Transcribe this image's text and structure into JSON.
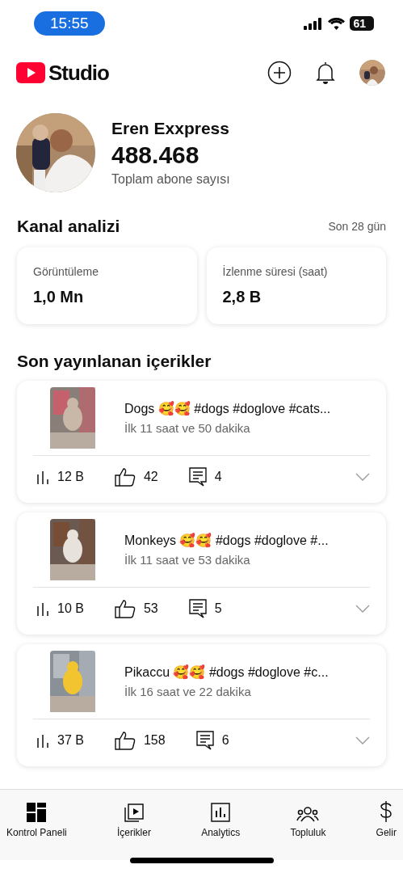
{
  "status_bar": {
    "time": "15:55",
    "battery": "61"
  },
  "header": {
    "logo_text": "Studio"
  },
  "channel": {
    "name": "Eren Exxpress",
    "subscribers": "488.468",
    "subscribers_label": "Toplam abone sayısı"
  },
  "analytics": {
    "title": "Kanal analizi",
    "period": "Son 28 gün",
    "cards": [
      {
        "label": "Görüntüleme",
        "value": "1,0 Mn"
      },
      {
        "label": "İzlenme süresi (saat)",
        "value": "2,8 B"
      }
    ]
  },
  "recent": {
    "title": "Son yayınlanan içerikler",
    "items": [
      {
        "title": "Dogs 🥰🥰 #dogs #doglove #cats...",
        "period": "İlk 11 saat ve 50 dakika",
        "views": "12 B",
        "likes": "42",
        "comments": "4"
      },
      {
        "title": "Monkeys 🥰🥰 #dogs #doglove #...",
        "period": "İlk 11 saat ve 53 dakika",
        "views": "10 B",
        "likes": "53",
        "comments": "5"
      },
      {
        "title": "Pikaccu 🥰🥰 #dogs #doglove #c...",
        "period": "İlk 16 saat ve 22 dakika",
        "views": "37 B",
        "likes": "158",
        "comments": "6"
      }
    ]
  },
  "nav": [
    {
      "label": "Kontrol Paneli",
      "kind": "dashboard"
    },
    {
      "label": "İçerikler",
      "kind": "content"
    },
    {
      "label": "Analytics",
      "kind": "analytics"
    },
    {
      "label": "Topluluk",
      "kind": "community"
    },
    {
      "label": "Gelir",
      "kind": "earn"
    }
  ]
}
